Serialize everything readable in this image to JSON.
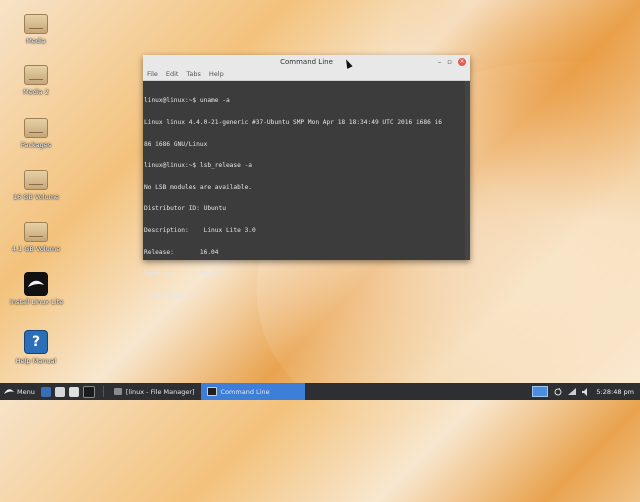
{
  "desktop": {
    "icons": [
      {
        "label": "Media"
      },
      {
        "label": "Media 2"
      },
      {
        "label": "Packages"
      },
      {
        "label": "16 GB Volume"
      },
      {
        "label": "4.1 GB Volume"
      },
      {
        "label": "Install Linux Lite"
      },
      {
        "label": "Help Manual"
      }
    ]
  },
  "window": {
    "title": "Command Line",
    "menu": [
      "File",
      "Edit",
      "Tabs",
      "Help"
    ],
    "lines": [
      "linux@linux:~$ uname -a",
      "Linux linux 4.4.0-21-generic #37-Ubuntu SMP Mon Apr 18 18:34:49 UTC 2016 i686 i6",
      "86 i686 GNU/Linux",
      "linux@linux:~$ lsb_release -a",
      "No LSB modules are available.",
      "Distributor ID: Ubuntu",
      "Description:    Linux Lite 3.0",
      "Release:       16.04",
      "Codename:      xenial",
      "linux@linux:~$"
    ]
  },
  "taskbar": {
    "menu_label": "Menu",
    "tasks": [
      {
        "label": "[linux - File Manager]",
        "active": false
      },
      {
        "label": "Command Line",
        "active": true
      }
    ],
    "clock": "5:28:48 pm"
  },
  "colors": {
    "taskbar_bg": "#2d2f33",
    "active_task": "#3d7fd8",
    "terminal_bg": "#3c3c3c"
  }
}
